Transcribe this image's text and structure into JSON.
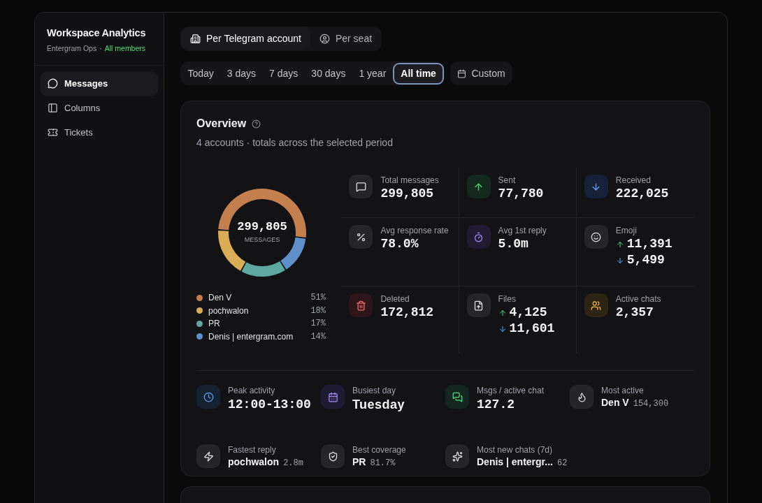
{
  "sidebar": {
    "title": "Workspace Analytics",
    "subtitle": "Entergram Ops",
    "separator": "·",
    "scope": "All members",
    "items": [
      {
        "label": "Messages",
        "selected": true
      },
      {
        "label": "Columns",
        "selected": false
      },
      {
        "label": "Tickets",
        "selected": false
      }
    ]
  },
  "modes": [
    {
      "label": "Per Telegram account",
      "selected": true
    },
    {
      "label": "Per seat",
      "selected": false
    }
  ],
  "ranges": [
    {
      "label": "Today",
      "selected": false
    },
    {
      "label": "3 days",
      "selected": false
    },
    {
      "label": "7 days",
      "selected": false
    },
    {
      "label": "30 days",
      "selected": false
    },
    {
      "label": "1 year",
      "selected": false
    },
    {
      "label": "All time",
      "selected": true
    },
    {
      "label": "Custom",
      "selected": false
    }
  ],
  "overview": {
    "title": "Overview",
    "subtitle": "4 accounts · totals across the selected period",
    "donut": {
      "total": "299,805",
      "unit": "MESSAGES",
      "chart_data": {
        "type": "donut",
        "categories": [
          "Den V",
          "pochwalon",
          "PR",
          "Denis | entergram.com"
        ],
        "values": [
          51,
          18,
          17,
          14
        ]
      }
    },
    "legend": [
      {
        "share": "51%",
        "color": "#c47f4f"
      },
      {
        "share": "18%",
        "color": "#d9ad55"
      },
      {
        "share": "17%",
        "color": "#5fa8a0"
      },
      {
        "share": "14%",
        "color": "#5f8fcb"
      }
    ],
    "stats": [
      {
        "kind": "single",
        "label": "Total messages",
        "value": "299,805"
      },
      {
        "kind": "single",
        "label": "Sent",
        "value": "77,780"
      },
      {
        "kind": "single",
        "label": "Received",
        "value": "222,025"
      },
      {
        "kind": "single",
        "label": "Avg response rate",
        "value": "78.0%"
      },
      {
        "kind": "single",
        "label": "Avg 1st reply",
        "value": "5.0m"
      },
      {
        "kind": "pair",
        "label": "Emoji",
        "up": "11,391",
        "down": "5,499"
      },
      {
        "kind": "single",
        "label": "Deleted",
        "value": "172,812"
      },
      {
        "kind": "pair",
        "label": "Files",
        "up": "4,125",
        "down": "11,601"
      },
      {
        "kind": "single",
        "label": "Active chats",
        "value": "2,357"
      }
    ],
    "highlights": [
      {
        "kind": "mono",
        "label": "Peak activity",
        "value": "12:00-13:00"
      },
      {
        "kind": "text",
        "label": "Busiest day",
        "value": "Tuesday"
      },
      {
        "kind": "mono",
        "label": "Msgs / active chat",
        "value": "127.2"
      },
      {
        "kind": "name",
        "label": "Most active",
        "value": "Den V",
        "note": "154,300"
      },
      {
        "kind": "name",
        "label": "Fastest reply",
        "value": "pochwalon",
        "note": "2.8m"
      },
      {
        "kind": "name",
        "label": "Best coverage",
        "value": "PR",
        "note": "81.7%"
      },
      {
        "kind": "name",
        "label": "Most new chats (7d)",
        "value": "Denis | entergr...",
        "note": "62"
      }
    ]
  }
}
